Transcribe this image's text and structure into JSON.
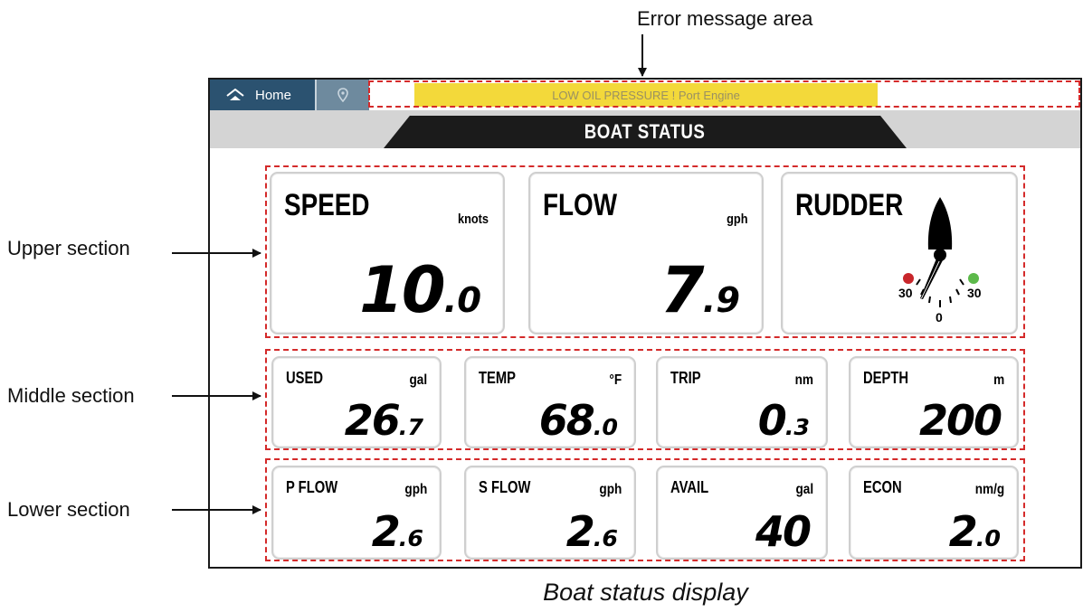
{
  "annotations": {
    "error_area": "Error message area",
    "upper": "Upper section",
    "middle": "Middle section",
    "lower": "Lower section",
    "caption": "Boat status display"
  },
  "topbar": {
    "home_label": "Home",
    "home_icon": "house-icon",
    "location_icon": "location-pin-icon",
    "alarm_text": "LOW OIL PRESSURE ! Port Engine"
  },
  "title": "BOAT STATUS",
  "upper": [
    {
      "label": "SPEED",
      "unit": "knots",
      "int": "10",
      "dec": ".0"
    },
    {
      "label": "FLOW",
      "unit": "gph",
      "int": "7",
      "dec": ".9"
    }
  ],
  "rudder": {
    "label": "RUDDER",
    "scale_left": "30",
    "scale_center": "0",
    "scale_right": "30",
    "port_color": "#c8262b",
    "starboard_color": "#5cb94a",
    "angle_deg": 22
  },
  "middle": [
    {
      "label": "USED",
      "unit": "gal",
      "int": "26",
      "dec": ".7"
    },
    {
      "label": "TEMP",
      "unit": "°F",
      "int": "68",
      "dec": ".0"
    },
    {
      "label": "TRIP",
      "unit": "nm",
      "int": "0",
      "dec": ".3"
    },
    {
      "label": "DEPTH",
      "unit": "m",
      "int": "200",
      "dec": ""
    }
  ],
  "lower": [
    {
      "label": "P FLOW",
      "unit": "gph",
      "int": "2",
      "dec": ".6"
    },
    {
      "label": "S FLOW",
      "unit": "gph",
      "int": "2",
      "dec": ".6"
    },
    {
      "label": "AVAIL",
      "unit": "gal",
      "int": "40",
      "dec": ""
    },
    {
      "label": "ECON",
      "unit": "nm/g",
      "int": "2",
      "dec": ".0"
    }
  ]
}
